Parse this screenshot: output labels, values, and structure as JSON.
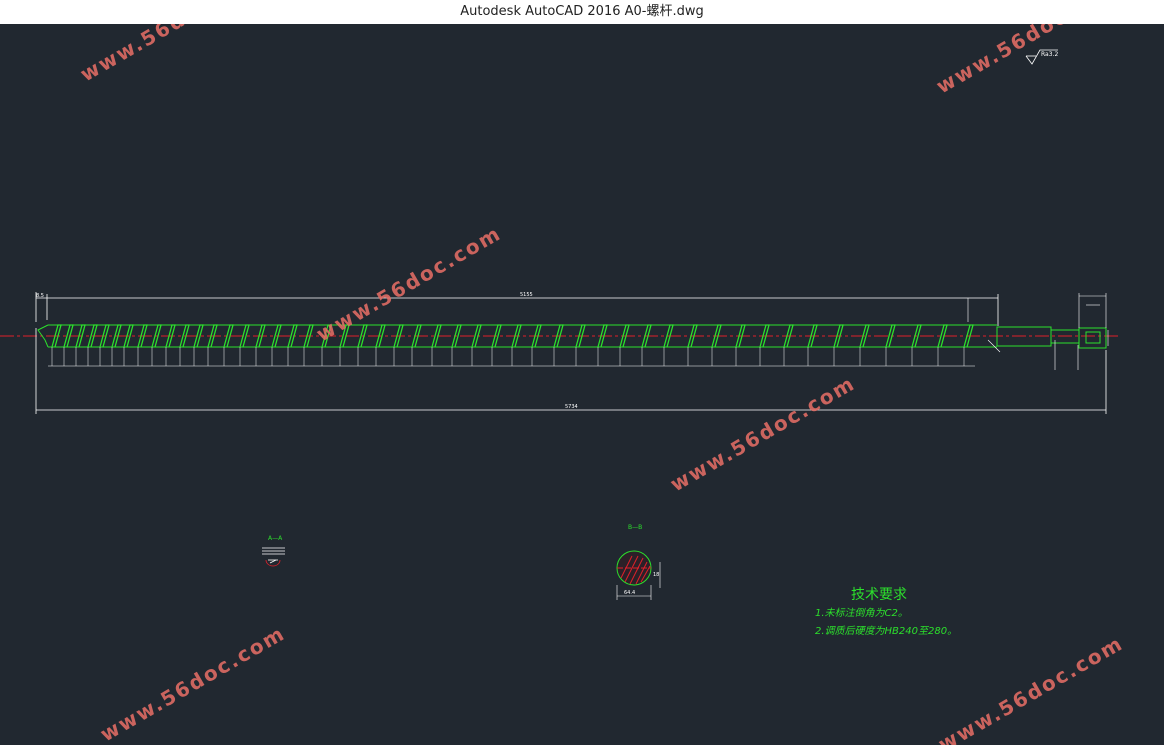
{
  "window": {
    "title": "Autodesk AutoCAD 2016     A0-螺杆.dwg"
  },
  "drawing": {
    "roughness_symbol": "Ra3.2",
    "dim_overall": "5734",
    "dim_flight": "5155",
    "dim_left": "8.5",
    "section_a": "A—A",
    "section_b": "B—B",
    "section_b_dims": [
      "64.4",
      "18"
    ],
    "tech_req": {
      "title": "技术要求",
      "lines": [
        "1.未标注倒角为C2。",
        "2.调质后硬度为HB240至280。"
      ]
    }
  },
  "watermark": {
    "text": "www.56doc.com"
  },
  "colors": {
    "background": "#212830",
    "line": "#2ce02c",
    "dim": "#ffffff",
    "center": "#e0202a",
    "watermark": "#e26c64"
  }
}
